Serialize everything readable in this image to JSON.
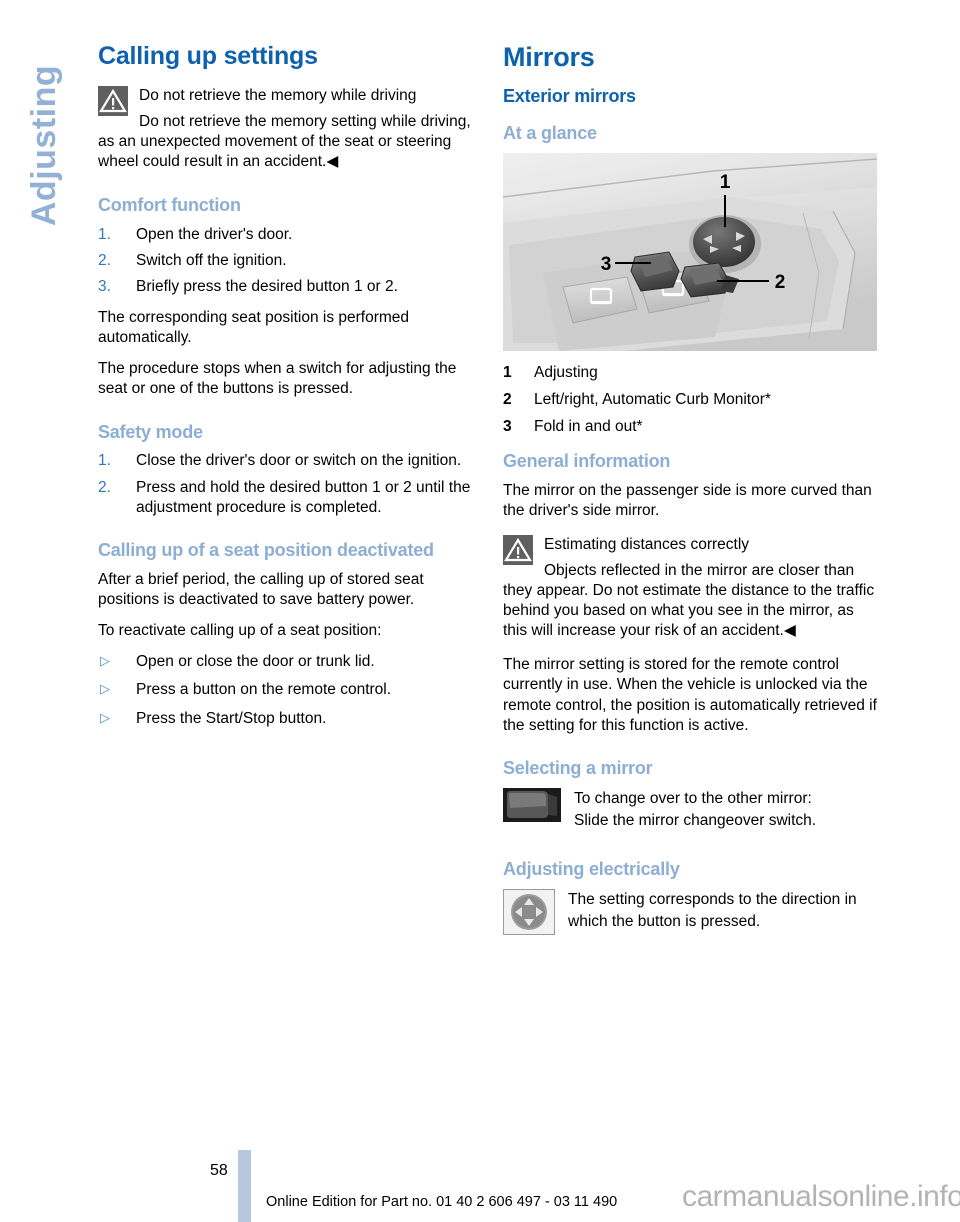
{
  "chapter_tab": {
    "label": "Adjusting"
  },
  "left_column": {
    "heading": "Calling up settings",
    "warning": {
      "icon": "warning-triangle-icon",
      "title": "Do not retrieve the memory while driving",
      "body": "Do not retrieve the memory setting while driving, as an unexpected movement of the seat or steering wheel could result in an accident.◀"
    },
    "comfort": {
      "heading": "Comfort function",
      "steps": [
        {
          "num": "1.",
          "text": "Open the driver's door."
        },
        {
          "num": "2.",
          "text": "Switch off the ignition."
        },
        {
          "num": "3.",
          "text": "Briefly press the desired button 1 or 2."
        }
      ],
      "para1": "The corresponding seat position is performed automatically.",
      "para2": "The procedure stops when a switch for adjusting the seat or one of the buttons is pressed."
    },
    "safety": {
      "heading": "Safety mode",
      "steps": [
        {
          "num": "1.",
          "text": "Close the driver's door or switch on the ignition."
        },
        {
          "num": "2.",
          "text": "Press and hold the desired button 1 or 2 until the adjustment procedure is completed."
        }
      ]
    },
    "deactivated": {
      "heading": "Calling up of a seat position deactivated",
      "para1": "After a brief period, the calling up of stored seat positions is deactivated to save battery power.",
      "para2": "To reactivate calling up of a seat position:",
      "bullets": [
        "Open or close the door or trunk lid.",
        "Press a button on the remote control.",
        "Press the Start/Stop button."
      ]
    }
  },
  "right_column": {
    "heading": "Mirrors",
    "subheading": "Exterior mirrors",
    "at_a_glance": {
      "heading": "At a glance",
      "photo_alt": "door-panel-mirror-controls-photo",
      "photo_callouts": [
        "1",
        "2",
        "3"
      ],
      "legend": [
        {
          "num": "1",
          "text": "Adjusting"
        },
        {
          "num": "2",
          "text": "Left/right, Automatic Curb Monitor*"
        },
        {
          "num": "3",
          "text": "Fold in and out*"
        }
      ]
    },
    "general_information": {
      "heading": "General information",
      "para1": "The mirror on the passenger side is more curved than the driver's side mirror.",
      "warning": {
        "icon": "warning-triangle-icon",
        "title": "Estimating distances correctly",
        "body": "Objects reflected in the mirror are closer than they appear. Do not estimate the distance to the traffic behind you based on what you see in the mirror, as this will increase your risk of an accident.◀"
      },
      "para2": "The mirror setting is stored for the remote control currently in use. When the vehicle is unlocked via the remote control, the position is automatically retrieved if the setting for this function is active."
    },
    "selecting_mirror": {
      "heading": "Selecting a mirror",
      "icon": "mirror-changeover-switch-icon",
      "line1": "To change over to the other mirror:",
      "line2": "Slide the mirror changeover switch."
    },
    "adjusting_electrically": {
      "heading": "Adjusting electrically",
      "icon": "four-way-direction-knob-icon",
      "text": "The setting corresponds to the direction in which the button is pressed."
    }
  },
  "footer": {
    "page_number": "58",
    "text": "Online Edition for Part no. 01 40 2 606 497 - 03 11 490",
    "watermark": "carmanualsonline.info"
  },
  "colors": {
    "heading_dark_blue": "#0d61ad",
    "heading_light_blue": "#8daed4",
    "list_number_blue": "#2f78bd",
    "tab_blue": "#93b0d6",
    "page_bar": "#b6c7de",
    "warning_icon_bg": "#5f5f5f",
    "watermark_gray": "#b3b3b3"
  }
}
